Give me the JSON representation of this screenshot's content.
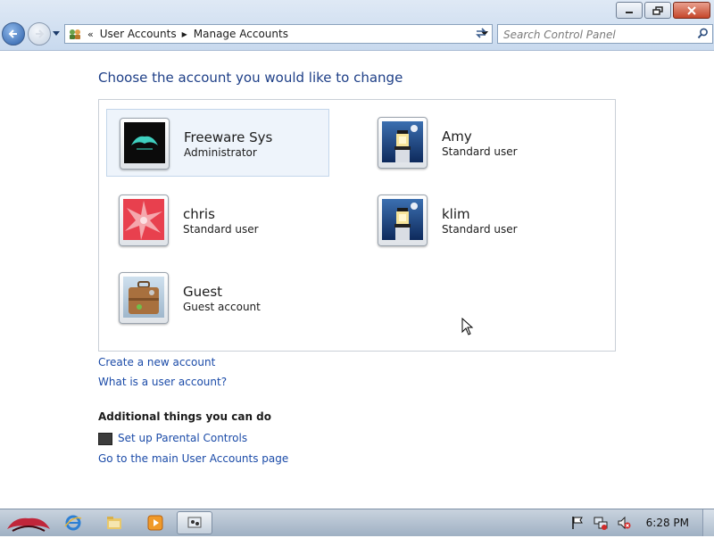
{
  "window": {
    "controls": {
      "minimize_icon": "minimize-icon",
      "restore_icon": "restore-icon",
      "close_icon": "close-icon"
    }
  },
  "address_bar": {
    "overflow": "«",
    "breadcrumbs": [
      "User Accounts",
      "Manage Accounts"
    ],
    "icon": "user-accounts-icon"
  },
  "search": {
    "placeholder": "Search Control Panel"
  },
  "main": {
    "heading": "Choose the account you would like to change",
    "accounts": [
      {
        "name": "Freeware Sys",
        "type": "Administrator",
        "picture": "rog-logo-picture",
        "selected": true
      },
      {
        "name": "Amy",
        "type": "Standard user",
        "picture": "lighthouse-picture",
        "selected": false
      },
      {
        "name": "chris",
        "type": "Standard user",
        "picture": "red-star-picture",
        "selected": false
      },
      {
        "name": "klim",
        "type": "Standard user",
        "picture": "lighthouse-picture",
        "selected": false
      },
      {
        "name": "Guest",
        "type": "Guest account",
        "picture": "suitcase-picture",
        "selected": false
      }
    ],
    "links": {
      "create_account": "Create a new account",
      "what_is_account": "What is a user account?"
    },
    "additional": {
      "heading": "Additional things you can do",
      "parental_controls": "Set up Parental Controls",
      "main_page": "Go to the main User Accounts page"
    }
  },
  "taskbar": {
    "items": [
      "start-orb",
      "internet-explorer-icon",
      "windows-explorer-icon",
      "media-player-icon",
      "control-panel-icon"
    ],
    "clock": "6:28 PM"
  },
  "colors": {
    "heading": "#1e3f87",
    "link": "#1b4ba8",
    "selected_bg": "#eef4fb"
  }
}
